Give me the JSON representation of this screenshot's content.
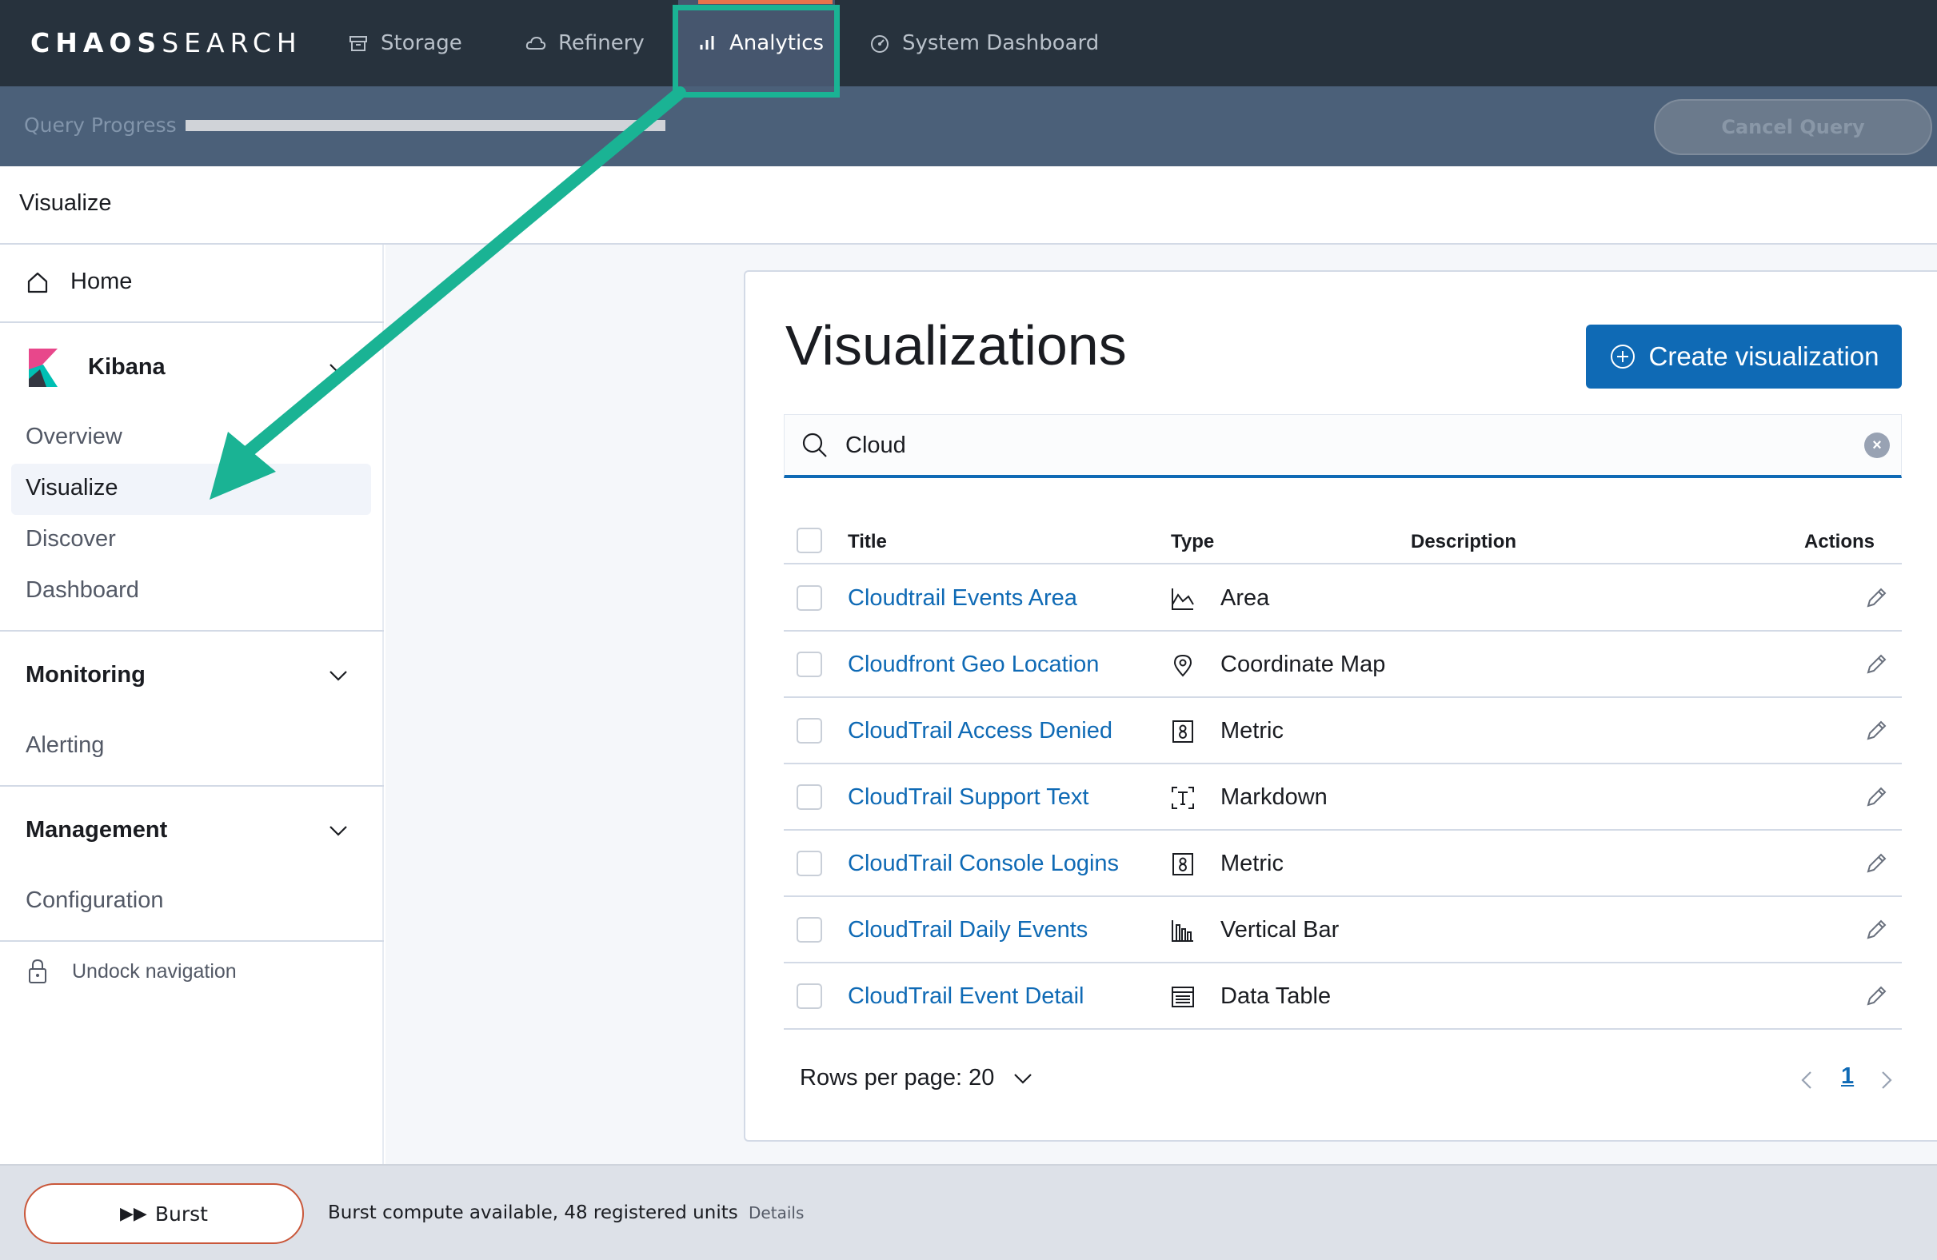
{
  "app": {
    "logo_bold": "CHAOS",
    "logo_light": "SEARCH"
  },
  "topnav": {
    "items": [
      {
        "label": "Storage",
        "icon": "storage-icon"
      },
      {
        "label": "Refinery",
        "icon": "cloud-icon"
      },
      {
        "label": "Analytics",
        "icon": "bar-chart-icon"
      },
      {
        "label": "System Dashboard",
        "icon": "dashboard-icon"
      }
    ],
    "active": "Analytics"
  },
  "query": {
    "label": "Query Progress",
    "cancel_label": "Cancel Query"
  },
  "breadcrumb": "Visualize",
  "sidebar": {
    "home": "Home",
    "kibana": "Kibana",
    "kibana_links": [
      "Overview",
      "Visualize",
      "Discover",
      "Dashboard"
    ],
    "selected": "Visualize",
    "monitoring": "Monitoring",
    "monitoring_links": [
      "Alerting"
    ],
    "management": "Management",
    "management_links": [
      "Configuration"
    ],
    "undock": "Undock navigation"
  },
  "main": {
    "title": "Visualizations",
    "create_label": "Create visualization",
    "search_value": "Cloud",
    "columns": {
      "title": "Title",
      "type": "Type",
      "description": "Description",
      "actions": "Actions"
    },
    "rows": [
      {
        "title": "Cloudtrail Events Area",
        "type": "Area",
        "type_icon": "area-chart-icon"
      },
      {
        "title": "Cloudfront Geo Location",
        "type": "Coordinate Map",
        "type_icon": "map-pin-icon"
      },
      {
        "title": "CloudTrail Access Denied",
        "type": "Metric",
        "type_icon": "metric-icon"
      },
      {
        "title": "CloudTrail Support Text",
        "type": "Markdown",
        "type_icon": "markdown-icon"
      },
      {
        "title": "CloudTrail Console Logins",
        "type": "Metric",
        "type_icon": "metric-icon"
      },
      {
        "title": "CloudTrail Daily Events",
        "type": "Vertical Bar",
        "type_icon": "vertical-bar-icon"
      },
      {
        "title": "CloudTrail Event Detail",
        "type": "Data Table",
        "type_icon": "data-table-icon"
      }
    ],
    "rows_per_page": "Rows per page: 20",
    "current_page": "1"
  },
  "footer": {
    "burst_label": "Burst",
    "status_text": "Burst compute available, 48 registered units",
    "details_link": "Details"
  },
  "colors": {
    "nav_bg": "#27323d",
    "progress_bg": "#4b6079",
    "primary": "#0f6ab5",
    "annotation": "#1ab394",
    "active_indicator": "#e8734c"
  }
}
